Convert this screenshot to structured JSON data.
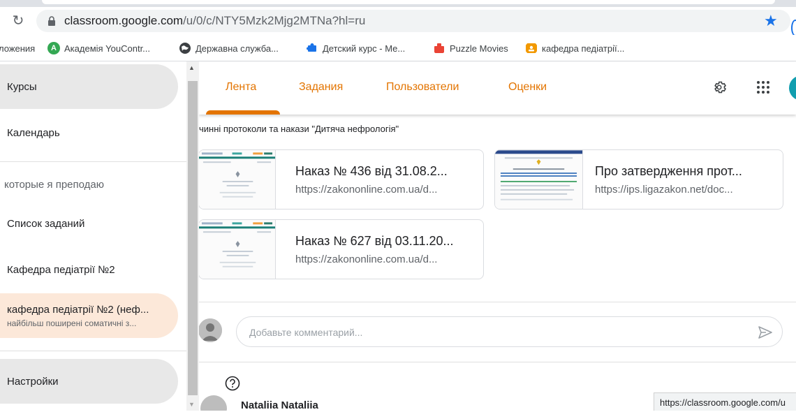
{
  "browser": {
    "url_host": "classroom.google.com",
    "url_path": "/u/0/c/NTY5Mzk2Mjg2MTNa?hl=ru",
    "reload_icon": "reload-icon",
    "star_icon": "bookmark-star-icon"
  },
  "bookmarks": [
    {
      "label": "ложения",
      "icon": ""
    },
    {
      "label": "Академія YouContr...",
      "icon": "A",
      "color": "#34a853"
    },
    {
      "label": "Державна служба...",
      "icon": "globe",
      "color": "#3c4043"
    },
    {
      "label": "Детский курс - Ме...",
      "icon": "puzzle",
      "color": "#1a73e8"
    },
    {
      "label": "Puzzle Movies",
      "icon": "puzzle",
      "color": "#ea4335"
    },
    {
      "label": "кафедра педіатрії...",
      "icon": "board",
      "color": "#f29900"
    }
  ],
  "tabs": {
    "stream": "Лента",
    "classwork": "Задания",
    "people": "Пользователи",
    "grades": "Оценки"
  },
  "post": {
    "title": "чинні протоколи та накази \"Дитяча нефрологія\""
  },
  "attachments": [
    {
      "title": "Наказ № 436 від 31.08.2...",
      "url": "https://zakononline.com.ua/d..."
    },
    {
      "title": "Про затвердження прот...",
      "url": "https://ips.ligazakon.net/doc..."
    },
    {
      "title": "Наказ № 627 від 03.11.20...",
      "url": "https://zakononline.com.ua/d..."
    }
  ],
  "comment": {
    "placeholder": "Добавьте комментарий..."
  },
  "next_post": {
    "author": "Nataliia Nataliia"
  },
  "status_tip": "https://classroom.google.com/u",
  "drawer": {
    "courses": "Курсы",
    "calendar": "Календарь",
    "teaching_section": "которые я преподаю",
    "todo": "Список заданий",
    "class1": "Кафедра педіатрії №2",
    "class2_title": "кафедра педіатрії №2 (неф...",
    "class2_subtitle": "найбільш поширені соматичні з...",
    "settings": "Настройки"
  },
  "colors": {
    "accent": "#e37400",
    "selected_bg": "#fce8d9",
    "active_bg": "#e8e8e8",
    "link_blue": "#1a73e8"
  }
}
